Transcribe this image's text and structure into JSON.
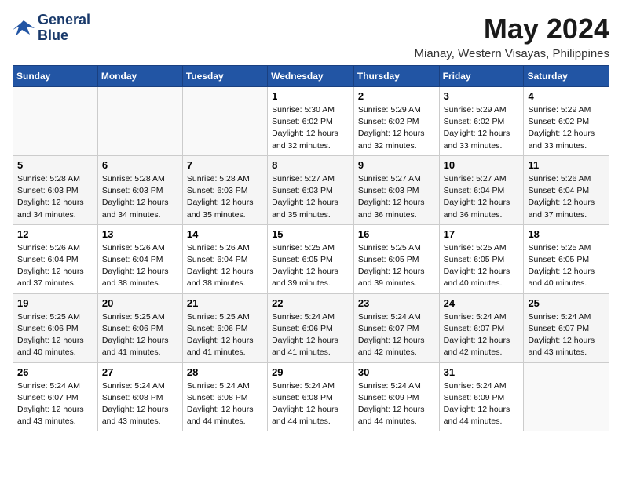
{
  "logo": {
    "line1": "General",
    "line2": "Blue"
  },
  "title": "May 2024",
  "location": "Mianay, Western Visayas, Philippines",
  "days_header": [
    "Sunday",
    "Monday",
    "Tuesday",
    "Wednesday",
    "Thursday",
    "Friday",
    "Saturday"
  ],
  "weeks": [
    [
      {
        "day": "",
        "info": ""
      },
      {
        "day": "",
        "info": ""
      },
      {
        "day": "",
        "info": ""
      },
      {
        "day": "1",
        "info": "Sunrise: 5:30 AM\nSunset: 6:02 PM\nDaylight: 12 hours\nand 32 minutes."
      },
      {
        "day": "2",
        "info": "Sunrise: 5:29 AM\nSunset: 6:02 PM\nDaylight: 12 hours\nand 32 minutes."
      },
      {
        "day": "3",
        "info": "Sunrise: 5:29 AM\nSunset: 6:02 PM\nDaylight: 12 hours\nand 33 minutes."
      },
      {
        "day": "4",
        "info": "Sunrise: 5:29 AM\nSunset: 6:02 PM\nDaylight: 12 hours\nand 33 minutes."
      }
    ],
    [
      {
        "day": "5",
        "info": "Sunrise: 5:28 AM\nSunset: 6:03 PM\nDaylight: 12 hours\nand 34 minutes."
      },
      {
        "day": "6",
        "info": "Sunrise: 5:28 AM\nSunset: 6:03 PM\nDaylight: 12 hours\nand 34 minutes."
      },
      {
        "day": "7",
        "info": "Sunrise: 5:28 AM\nSunset: 6:03 PM\nDaylight: 12 hours\nand 35 minutes."
      },
      {
        "day": "8",
        "info": "Sunrise: 5:27 AM\nSunset: 6:03 PM\nDaylight: 12 hours\nand 35 minutes."
      },
      {
        "day": "9",
        "info": "Sunrise: 5:27 AM\nSunset: 6:03 PM\nDaylight: 12 hours\nand 36 minutes."
      },
      {
        "day": "10",
        "info": "Sunrise: 5:27 AM\nSunset: 6:04 PM\nDaylight: 12 hours\nand 36 minutes."
      },
      {
        "day": "11",
        "info": "Sunrise: 5:26 AM\nSunset: 6:04 PM\nDaylight: 12 hours\nand 37 minutes."
      }
    ],
    [
      {
        "day": "12",
        "info": "Sunrise: 5:26 AM\nSunset: 6:04 PM\nDaylight: 12 hours\nand 37 minutes."
      },
      {
        "day": "13",
        "info": "Sunrise: 5:26 AM\nSunset: 6:04 PM\nDaylight: 12 hours\nand 38 minutes."
      },
      {
        "day": "14",
        "info": "Sunrise: 5:26 AM\nSunset: 6:04 PM\nDaylight: 12 hours\nand 38 minutes."
      },
      {
        "day": "15",
        "info": "Sunrise: 5:25 AM\nSunset: 6:05 PM\nDaylight: 12 hours\nand 39 minutes."
      },
      {
        "day": "16",
        "info": "Sunrise: 5:25 AM\nSunset: 6:05 PM\nDaylight: 12 hours\nand 39 minutes."
      },
      {
        "day": "17",
        "info": "Sunrise: 5:25 AM\nSunset: 6:05 PM\nDaylight: 12 hours\nand 40 minutes."
      },
      {
        "day": "18",
        "info": "Sunrise: 5:25 AM\nSunset: 6:05 PM\nDaylight: 12 hours\nand 40 minutes."
      }
    ],
    [
      {
        "day": "19",
        "info": "Sunrise: 5:25 AM\nSunset: 6:06 PM\nDaylight: 12 hours\nand 40 minutes."
      },
      {
        "day": "20",
        "info": "Sunrise: 5:25 AM\nSunset: 6:06 PM\nDaylight: 12 hours\nand 41 minutes."
      },
      {
        "day": "21",
        "info": "Sunrise: 5:25 AM\nSunset: 6:06 PM\nDaylight: 12 hours\nand 41 minutes."
      },
      {
        "day": "22",
        "info": "Sunrise: 5:24 AM\nSunset: 6:06 PM\nDaylight: 12 hours\nand 41 minutes."
      },
      {
        "day": "23",
        "info": "Sunrise: 5:24 AM\nSunset: 6:07 PM\nDaylight: 12 hours\nand 42 minutes."
      },
      {
        "day": "24",
        "info": "Sunrise: 5:24 AM\nSunset: 6:07 PM\nDaylight: 12 hours\nand 42 minutes."
      },
      {
        "day": "25",
        "info": "Sunrise: 5:24 AM\nSunset: 6:07 PM\nDaylight: 12 hours\nand 43 minutes."
      }
    ],
    [
      {
        "day": "26",
        "info": "Sunrise: 5:24 AM\nSunset: 6:07 PM\nDaylight: 12 hours\nand 43 minutes."
      },
      {
        "day": "27",
        "info": "Sunrise: 5:24 AM\nSunset: 6:08 PM\nDaylight: 12 hours\nand 43 minutes."
      },
      {
        "day": "28",
        "info": "Sunrise: 5:24 AM\nSunset: 6:08 PM\nDaylight: 12 hours\nand 44 minutes."
      },
      {
        "day": "29",
        "info": "Sunrise: 5:24 AM\nSunset: 6:08 PM\nDaylight: 12 hours\nand 44 minutes."
      },
      {
        "day": "30",
        "info": "Sunrise: 5:24 AM\nSunset: 6:09 PM\nDaylight: 12 hours\nand 44 minutes."
      },
      {
        "day": "31",
        "info": "Sunrise: 5:24 AM\nSunset: 6:09 PM\nDaylight: 12 hours\nand 44 minutes."
      },
      {
        "day": "",
        "info": ""
      }
    ]
  ]
}
